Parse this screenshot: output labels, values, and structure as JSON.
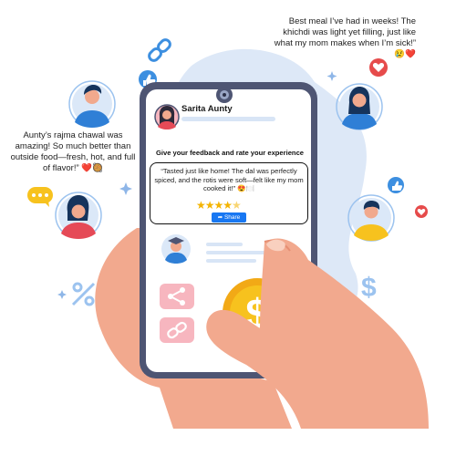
{
  "quotes": {
    "right": "Best meal I’ve had in weeks! The khichdi was light yet filling, just like what my mom makes when I’m sick!” 😢❤️",
    "left": "Aunty’s rajma chawal was amazing! So much better than outside food—fresh, hot, and full of flavor!” ❤️🥘"
  },
  "phone": {
    "profile_name": "Sarita Aunty",
    "feedback_title": "Give your feedback and rate your experience",
    "review_text": "“Tasted just like home! The dal was perfectly spiced, and the rotis were soft—felt like my mom cooked it!” 😍🍽️",
    "rating_stars": 4.5,
    "stars_full": "★★★★",
    "stars_half": "★",
    "share_label": "Share"
  },
  "icons": [
    "thumbs-up-icon",
    "heart-icon",
    "link-icon",
    "percent-icon",
    "dollar-icon",
    "share-icon",
    "chat-dots-icon"
  ],
  "colors": {
    "blob": "#dde8f7",
    "accent_blue": "#3d8fe0",
    "heart_red": "#e64b4b",
    "coin_yellow": "#f7c21e",
    "skin": "#f2a98e",
    "phone_frame": "#4e5573",
    "pink_button": "#f7b6bf"
  }
}
